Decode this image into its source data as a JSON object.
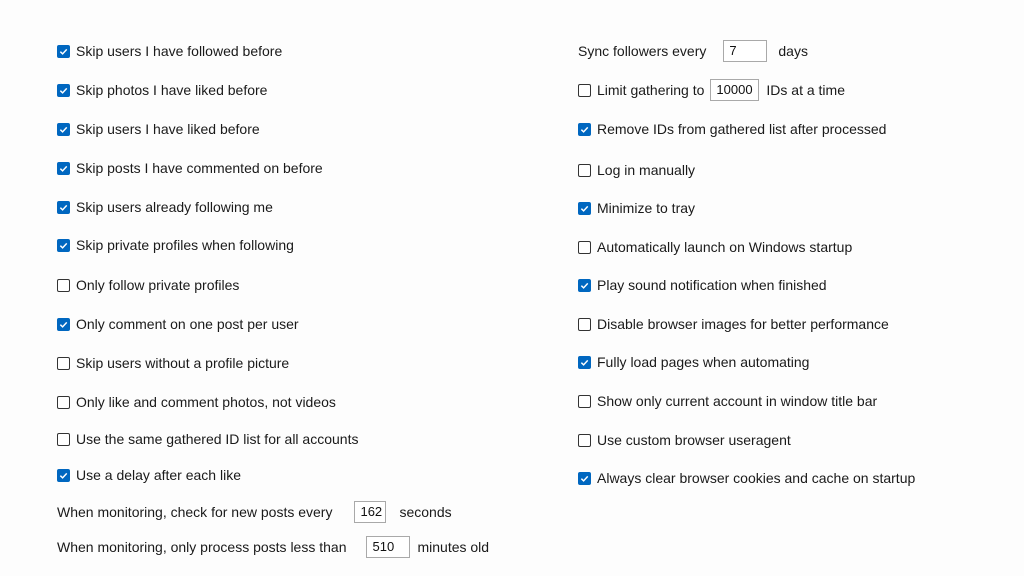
{
  "left_checks": [
    {
      "label": "Skip users I have followed before",
      "checked": true
    },
    {
      "label": "Skip photos I have liked before",
      "checked": true
    },
    {
      "label": "Skip users I have liked before",
      "checked": true
    },
    {
      "label": "Skip posts I have commented on before",
      "checked": true
    },
    {
      "label": "Skip users already following me",
      "checked": true
    },
    {
      "label": "Skip private profiles when following",
      "checked": true
    },
    {
      "label": "Only follow private profiles",
      "checked": false
    },
    {
      "label": "Only comment on one post per user",
      "checked": true
    },
    {
      "label": "Skip users without a profile picture",
      "checked": false
    },
    {
      "label": "Only like and comment photos, not videos",
      "checked": false
    },
    {
      "label": "Use the same gathered ID list for all accounts",
      "checked": false
    },
    {
      "label": "Use a delay after each like",
      "checked": true
    }
  ],
  "monitor": {
    "check_label": "When monitoring, check for new posts every",
    "check_value": "162",
    "check_unit": "seconds",
    "age_label": "When monitoring, only process posts less than",
    "age_value": "510",
    "age_unit": "minutes old"
  },
  "sync": {
    "label": "Sync followers every",
    "value": "7",
    "unit": "days"
  },
  "limit": {
    "label": "Limit gathering to",
    "value": "10000",
    "unit": "IDs at a time",
    "checked": false
  },
  "right_checks": [
    {
      "label": "Remove IDs from gathered list after processed",
      "checked": true
    },
    {
      "label": "Log in manually",
      "checked": false
    },
    {
      "label": "Minimize to tray",
      "checked": true
    },
    {
      "label": "Automatically launch on Windows startup",
      "checked": false
    },
    {
      "label": "Play sound notification when finished",
      "checked": true
    },
    {
      "label": "Disable browser images for better performance",
      "checked": false
    },
    {
      "label": "Fully load pages when automating",
      "checked": true
    },
    {
      "label": "Show only current account in window title bar",
      "checked": false
    },
    {
      "label": "Use custom browser useragent",
      "checked": false
    },
    {
      "label": "Always clear browser cookies and cache on startup",
      "checked": true
    }
  ],
  "colors": {
    "accent": "#0067c0"
  }
}
